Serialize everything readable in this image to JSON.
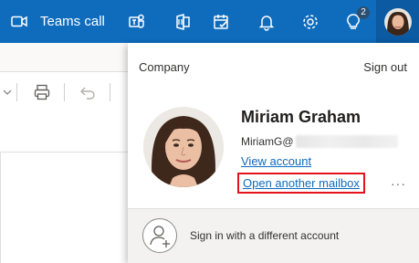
{
  "topbar": {
    "call_label": "Teams call",
    "badge_count": "2",
    "icons": [
      "video-icon",
      "teams-chat-icon",
      "office-icon",
      "task-icon",
      "bell-icon",
      "gear-icon",
      "lightbulb-icon"
    ]
  },
  "flyout": {
    "org_label": "Company",
    "sign_out": "Sign out",
    "user_name": "Miriam Graham",
    "email_prefix": "MiriamG@",
    "view_account": "View account",
    "open_mailbox": "Open another mailbox",
    "more": "···",
    "sign_in_other": "Sign in with a different account"
  },
  "colors": {
    "brand": "#0f6cbd",
    "highlight_box": "#e3141b"
  }
}
